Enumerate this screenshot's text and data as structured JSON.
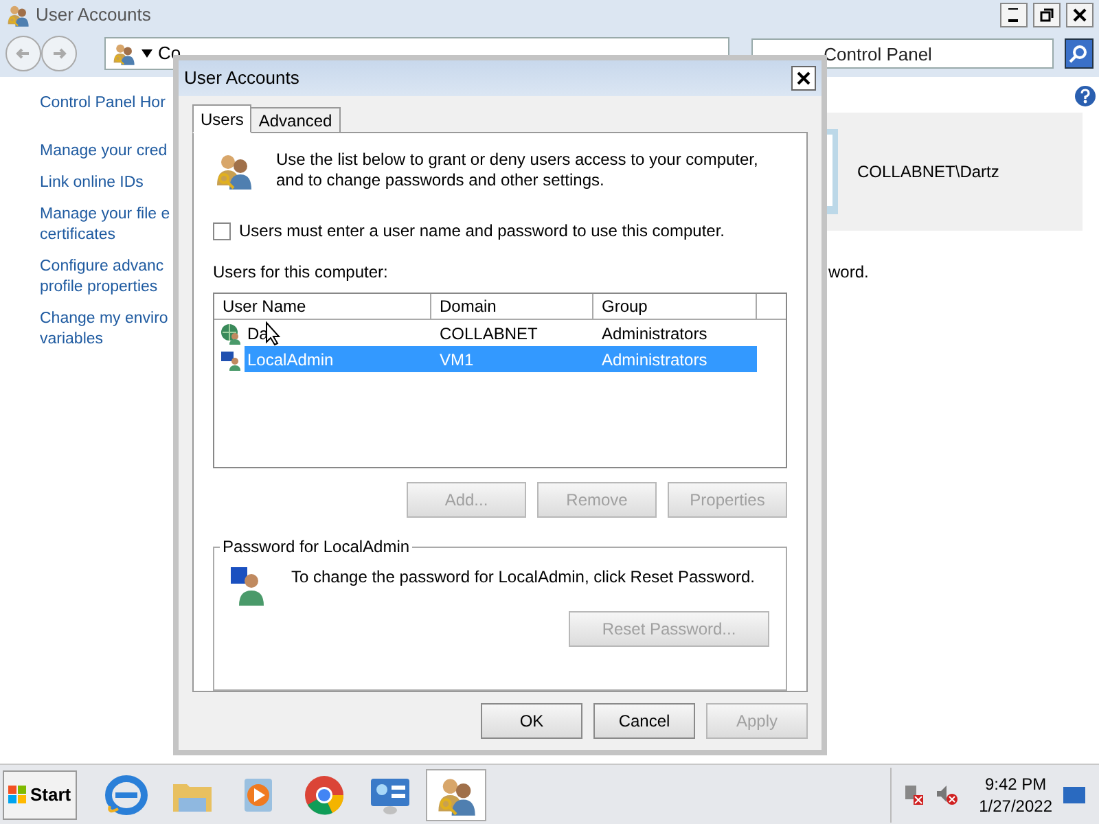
{
  "window": {
    "title": "User Accounts"
  },
  "address_bar": {
    "text": "Co"
  },
  "search": {
    "placeholder": "Control Panel"
  },
  "sidebar": {
    "items": [
      {
        "text": "Control Panel Hor"
      },
      {
        "text": "Manage your cred"
      },
      {
        "text": "Link online IDs"
      },
      {
        "text": "Manage your file e\ncertificates"
      },
      {
        "text": "Configure advanc\nprofile properties"
      },
      {
        "text": "Change my enviro\nvariables"
      }
    ]
  },
  "account_card": {
    "name": "COLLABNET\\Dartz"
  },
  "content_fragment": "word.",
  "dialog": {
    "title": "User Accounts",
    "tabs": [
      {
        "label": "Users",
        "selected": true
      },
      {
        "label": "Advanced",
        "selected": false
      }
    ],
    "intro": "Use the list below to grant or deny users access to your computer, and to change passwords and other settings.",
    "require_password": {
      "label": "Users must enter a user name and password to use this computer.",
      "checked": false
    },
    "users_label": "Users for this computer:",
    "table": {
      "columns": [
        "User Name",
        "Domain",
        "Group"
      ],
      "rows": [
        {
          "kind": "domain",
          "cells": [
            "Da",
            "COLLABNET",
            "Administrators"
          ],
          "selected": false
        },
        {
          "kind": "local",
          "cells": [
            "LocalAdmin",
            "VM1",
            "Administrators"
          ],
          "selected": true
        }
      ]
    },
    "list_buttons": [
      {
        "label": "Add...",
        "disabled": true
      },
      {
        "label": "Remove",
        "disabled": true
      },
      {
        "label": "Properties",
        "disabled": true
      }
    ],
    "password_group": {
      "title": "Password for LocalAdmin",
      "text": "To change the password for LocalAdmin, click Reset Password.",
      "button": {
        "label": "Reset Password...",
        "disabled": true
      }
    },
    "footer_buttons": [
      {
        "label": "OK",
        "disabled": false
      },
      {
        "label": "Cancel",
        "disabled": false
      },
      {
        "label": "Apply",
        "disabled": true
      }
    ]
  },
  "taskbar": {
    "start": "Start",
    "apps": [
      {
        "kind": "ie",
        "selected": false
      },
      {
        "kind": "folder",
        "selected": false
      },
      {
        "kind": "media",
        "selected": false
      },
      {
        "kind": "chrome",
        "selected": false
      },
      {
        "kind": "control",
        "selected": false
      },
      {
        "kind": "users",
        "selected": true
      }
    ],
    "time": "9:42 PM",
    "date": "1/27/2022"
  }
}
